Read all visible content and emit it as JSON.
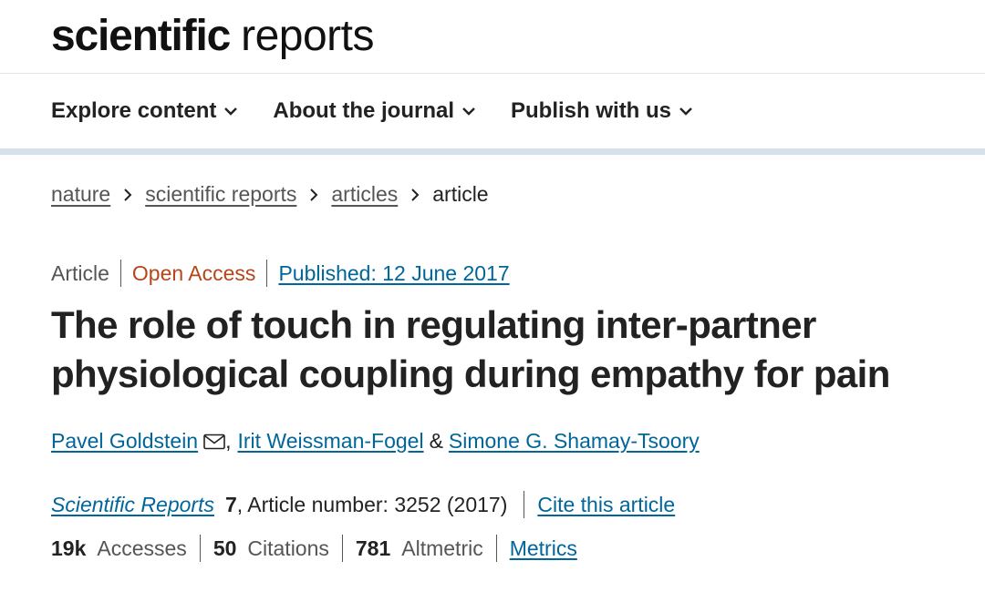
{
  "masthead": {
    "logo_bold": "scientific",
    "logo_light": "reports"
  },
  "nav": {
    "items": [
      {
        "label": "Explore content"
      },
      {
        "label": "About the journal"
      },
      {
        "label": "Publish with us"
      }
    ]
  },
  "breadcrumb": [
    "nature",
    "scientific reports",
    "articles",
    "article"
  ],
  "article": {
    "type": "Article",
    "access": "Open Access",
    "published": "Published: 12 June 2017",
    "title": "The role of touch in regulating inter-partner physiological coupling during empathy for pain",
    "authors": [
      "Pavel Goldstein",
      "Irit Weissman-Fogel",
      "Simone G. Shamay-Tsoory"
    ],
    "author_sep_comma": ",",
    "author_sep_amp": "&",
    "journal": "Scientific Reports",
    "volume": "7",
    "citation_rest": ", Article number: 3252 (2017)",
    "cite_label": "Cite this article",
    "metrics": {
      "accesses_value": "19k",
      "accesses_label": "Accesses",
      "citations_value": "50",
      "citations_label": "Citations",
      "altmetric_value": "781",
      "altmetric_label": "Altmetric",
      "link_label": "Metrics"
    }
  },
  "colors": {
    "link": "#006699",
    "open_access": "#b5461a",
    "nav_border": "#d5e1ea"
  },
  "icons": {
    "nav_dropdown": "chevron-down-icon",
    "breadcrumb_sep": "chevron-right-icon",
    "corresponding_author": "mail-icon"
  }
}
